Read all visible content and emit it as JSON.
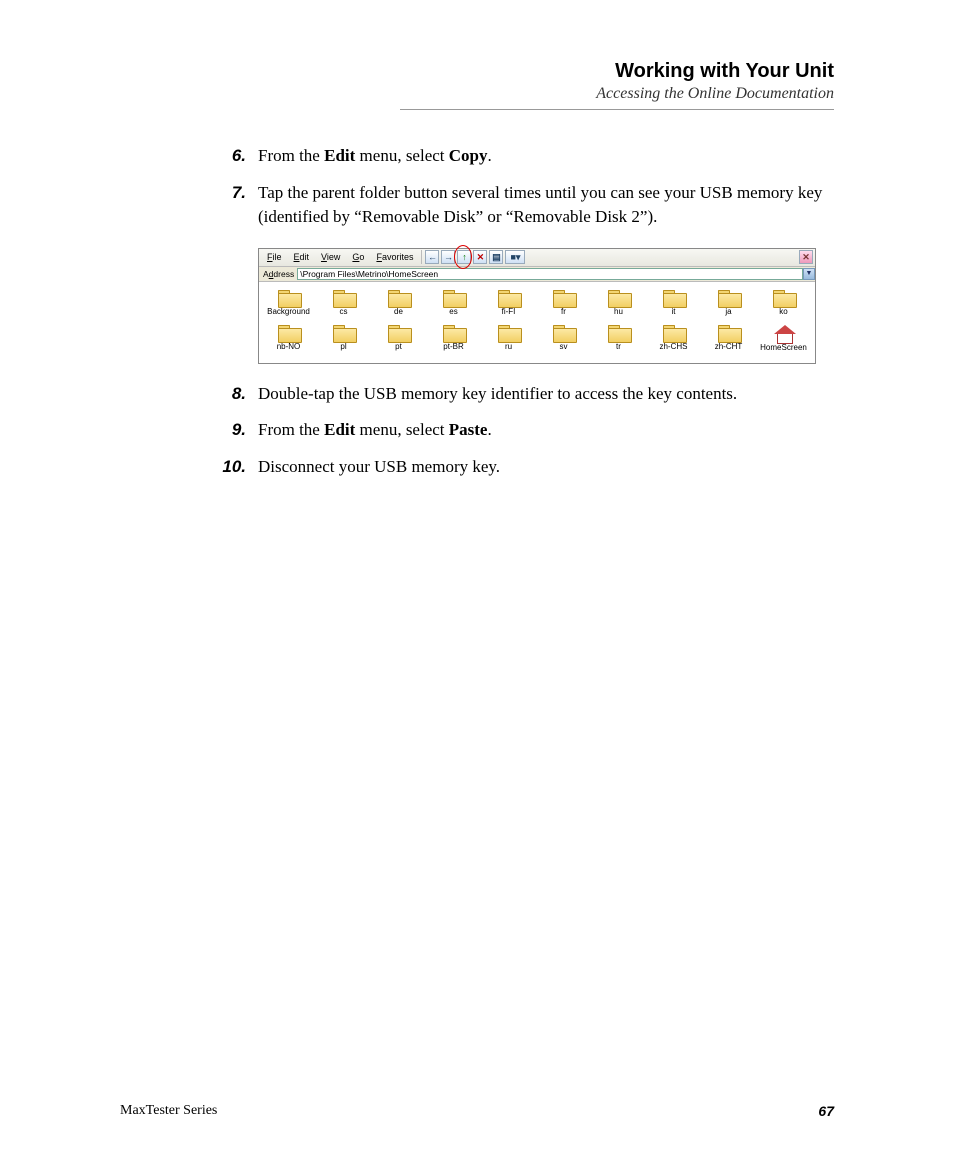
{
  "header": {
    "title": "Working with Your Unit",
    "subtitle": "Accessing the Online Documentation"
  },
  "steps": {
    "s6": {
      "num": "6.",
      "pre": "From the ",
      "b1": "Edit",
      "mid": " menu, select ",
      "b2": "Copy",
      "post": "."
    },
    "s7": {
      "num": "7.",
      "text": "Tap the parent folder button several times until you can see your USB memory key (identified by “Removable Disk” or “Removable Disk 2”)."
    },
    "s8": {
      "num": "8.",
      "text": "Double-tap the USB memory key identifier to access the key contents."
    },
    "s9": {
      "num": "9.",
      "pre": "From the ",
      "b1": "Edit",
      "mid": " menu, select ",
      "b2": "Paste",
      "post": "."
    },
    "s10": {
      "num": "10.",
      "text": "Disconnect your USB memory key."
    }
  },
  "explorer": {
    "menu": {
      "file": "File",
      "edit": "Edit",
      "view": "View",
      "go": "Go",
      "fav": "Favorites"
    },
    "addr": {
      "label": "Address",
      "path": "\\Program Files\\Metrino\\HomeScreen"
    },
    "row1": [
      "Background",
      "cs",
      "de",
      "es",
      "fi-FI",
      "fr",
      "hu",
      "it",
      "ja",
      "ko"
    ],
    "row2": [
      "nb-NO",
      "pl",
      "pt",
      "pt-BR",
      "ru",
      "sv",
      "tr",
      "zh-CHS",
      "zh-CHT",
      "HomeScreen"
    ]
  },
  "footer": {
    "series": "MaxTester Series",
    "page": "67"
  }
}
